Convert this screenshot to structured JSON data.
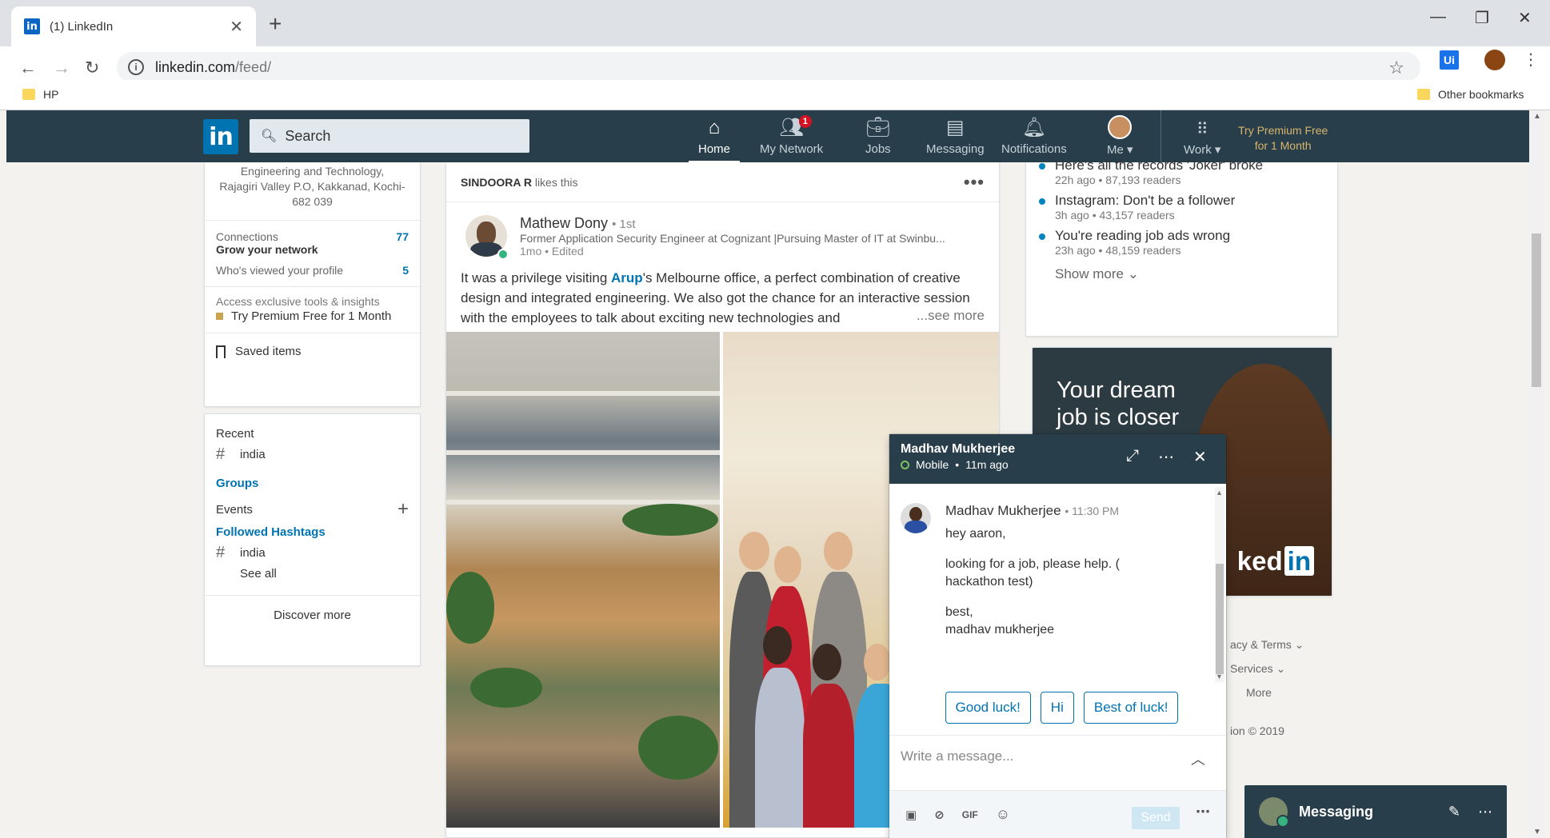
{
  "browser": {
    "tab_title": "(1) LinkedIn",
    "tab_favicon": "in",
    "url_host": "linkedin.com",
    "url_path": "/feed/",
    "bookmark_hp": "HP",
    "bookmark_other": "Other bookmarks",
    "ext_ui": "Ui"
  },
  "nav": {
    "logo": "in",
    "search_placeholder": "Search",
    "items": [
      {
        "label": "Home",
        "icon": "home-icon"
      },
      {
        "label": "My Network",
        "icon": "my-network-icon",
        "badge": "1"
      },
      {
        "label": "Jobs",
        "icon": "jobs-icon"
      },
      {
        "label": "Messaging",
        "icon": "messaging-icon"
      },
      {
        "label": "Notifications",
        "icon": "notifications-icon"
      },
      {
        "label": "Me",
        "icon": "me-avatar"
      },
      {
        "label": "Work",
        "icon": "work-grid-icon"
      }
    ],
    "premium_line1": "Try Premium Free",
    "premium_line2": "for 1 Month"
  },
  "left_rail": {
    "address_line1": "Engineering and Technology,",
    "address_line2": "Rajagiri Valley P.O, Kakkanad, Kochi-",
    "address_line3": "682 039",
    "connections_label": "Connections",
    "connections_count": "77",
    "grow_network": "Grow your network",
    "viewed_label": "Who's viewed your profile",
    "viewed_count": "5",
    "premium_access": "Access exclusive tools & insights",
    "premium_try": "Try Premium Free for 1 Month",
    "saved_items": "Saved items",
    "recent_label": "Recent",
    "recent_tag": "india",
    "groups_label": "Groups",
    "events_label": "Events",
    "followed_label": "Followed Hashtags",
    "followed_tag": "india",
    "see_all": "See all",
    "discover_more": "Discover more"
  },
  "feed": {
    "liker": "SINDOORA R",
    "likes_this": "likes this",
    "author_name": "Mathew Dony",
    "author_degree": "• 1st",
    "author_headline": "Former Application Security Engineer at Cognizant |Pursuing Master of IT at Swinbu...",
    "author_time": "1mo • Edited",
    "text_before": "It was a privilege visiting ",
    "mention": "Arup",
    "text_after": "'s Melbourne office, a perfect combination of creative design and integrated engineering. We also got the chance for an interactive session with the employees to talk about exciting new technologies and",
    "see_more": "...see more"
  },
  "news": {
    "items": [
      {
        "title": "Here's all the records 'Joker' broke",
        "meta": "22h ago • 87,193 readers"
      },
      {
        "title": "Instagram: Don't be a follower",
        "meta": "3h ago • 43,157 readers"
      },
      {
        "title": "You're reading job ads wrong",
        "meta": "23h ago • 48,159 readers"
      }
    ],
    "show_more": "Show more"
  },
  "ad": {
    "line1": "Your dream",
    "line2": "job is closer",
    "logo_text": "ked",
    "logo_in": "in"
  },
  "footer": {
    "privacy_terms": "acy & Terms",
    "services": "Services",
    "more": "More",
    "copyright": "ion © 2019"
  },
  "chat": {
    "name": "Madhav Mukherjee",
    "status": "Mobile",
    "last_seen": "11m ago",
    "msg_from": "Madhav Mukherjee",
    "msg_time": "• 11:30 PM",
    "lines": [
      "hey aaron,",
      "",
      "looking for a job, please help. (",
      "hackathon test)",
      "",
      "best,",
      "madhav mukherjee"
    ],
    "replies": [
      "Good luck!",
      "Hi",
      "Best of luck!"
    ],
    "compose_placeholder": "Write a message...",
    "send": "Send",
    "tool_gif": "GIF"
  },
  "dock": {
    "title": "Messaging"
  }
}
